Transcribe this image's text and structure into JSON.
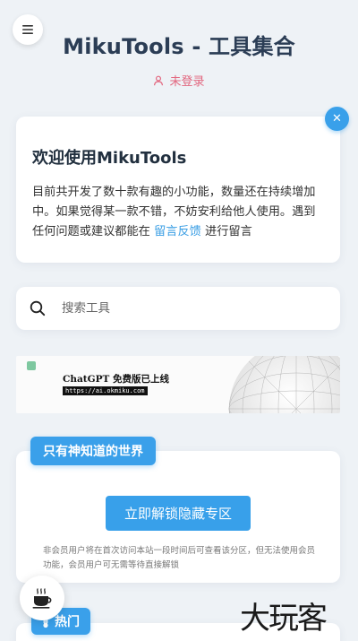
{
  "header": {
    "title": "MikuTools - 工具集合",
    "login_status": "未登录",
    "menu_icon": "menu-icon",
    "user_icon": "user-icon"
  },
  "welcome": {
    "title": "欢迎使用MikuTools",
    "body_before_link": "目前共开发了数十款有趣的小功能，数量还在持续增加中。如果觉得某一款不错，不妨安利给他人使用。遇到任何问题或建议都能在 ",
    "link_text": "留言反馈",
    "body_after_link": " 进行留言",
    "close_icon": "close-icon"
  },
  "search": {
    "placeholder": "搜索工具",
    "icon": "search-icon"
  },
  "banner": {
    "title": "ChatGPT 免费版已上线",
    "url": "https://ai.okmiku.com"
  },
  "secret_section": {
    "badge": "只有神知道的世界",
    "unlock_button": "立即解锁隐藏专区",
    "note": "非会员用户将在首次访问本站一段时间后可查看该分区，但无法使用会员功能，会员用户可无需等待直接解锁"
  },
  "hot_section": {
    "badge": "热门",
    "icon": "thermometer-icon"
  },
  "floating": {
    "coffee_icon": "coffee-icon"
  },
  "watermark": "大玩客",
  "colors": {
    "accent": "#38a0ea",
    "login_status": "#e2667e",
    "title": "#2b3d55",
    "background": "#eef2f6"
  }
}
